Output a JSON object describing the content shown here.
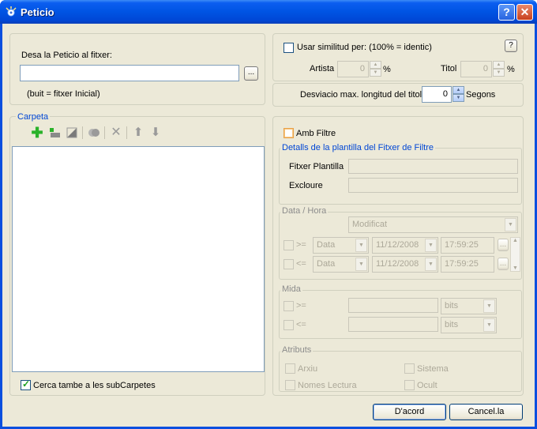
{
  "window": {
    "title": "Peticio",
    "help_label": "?",
    "close_label": "✕"
  },
  "save": {
    "label": "Desa la Peticio al fitxer:",
    "input_value": "",
    "browse_label": "...",
    "hint": "(buit = fitxer Inicial)"
  },
  "similarity": {
    "checkbox_label": "Usar similitud per: (100% = identic)",
    "help_label": "?",
    "artist_label": "Artista",
    "artist_value": "0",
    "title_label": "Titol",
    "title_value": "0",
    "percent": "%"
  },
  "deviation": {
    "label": "Desviacio max. longitud del titol",
    "value": "0",
    "unit": "Segons"
  },
  "folder": {
    "legend": "Carpeta",
    "subfolders_label": "Cerca tambe a les subCarpetes",
    "subfolders_checked": true
  },
  "filter": {
    "checkbox_label": "Amb Filtre",
    "template_legend": "Detalls de la plantilla del Fitxer de Filtre",
    "template_file_label": "Fitxer Plantilla",
    "exclude_label": "Excloure"
  },
  "datetime": {
    "legend": "Data / Hora",
    "mode": "Modificat",
    "rows": [
      {
        "op": ">=",
        "field": "Data",
        "date": "11/12/2008",
        "time": "17:59:25"
      },
      {
        "op": "<=",
        "field": "Data",
        "date": "11/12/2008",
        "time": "17:59:25"
      }
    ],
    "browse_label": "..."
  },
  "size": {
    "legend": "Mida",
    "rows": [
      {
        "op": ">=",
        "unit": "bits"
      },
      {
        "op": "<=",
        "unit": "bits"
      }
    ]
  },
  "attributes": {
    "legend": "Atributs",
    "items": [
      "Arxiu",
      "Sistema",
      "Nomes Lectura",
      "Ocult"
    ]
  },
  "footer": {
    "ok_label": "D'acord",
    "cancel_label": "Cancel.la"
  },
  "colors": {
    "title_bar": "#0054e3",
    "face": "#ece9d8",
    "legend": "#0046d5",
    "check": "#21a121"
  }
}
